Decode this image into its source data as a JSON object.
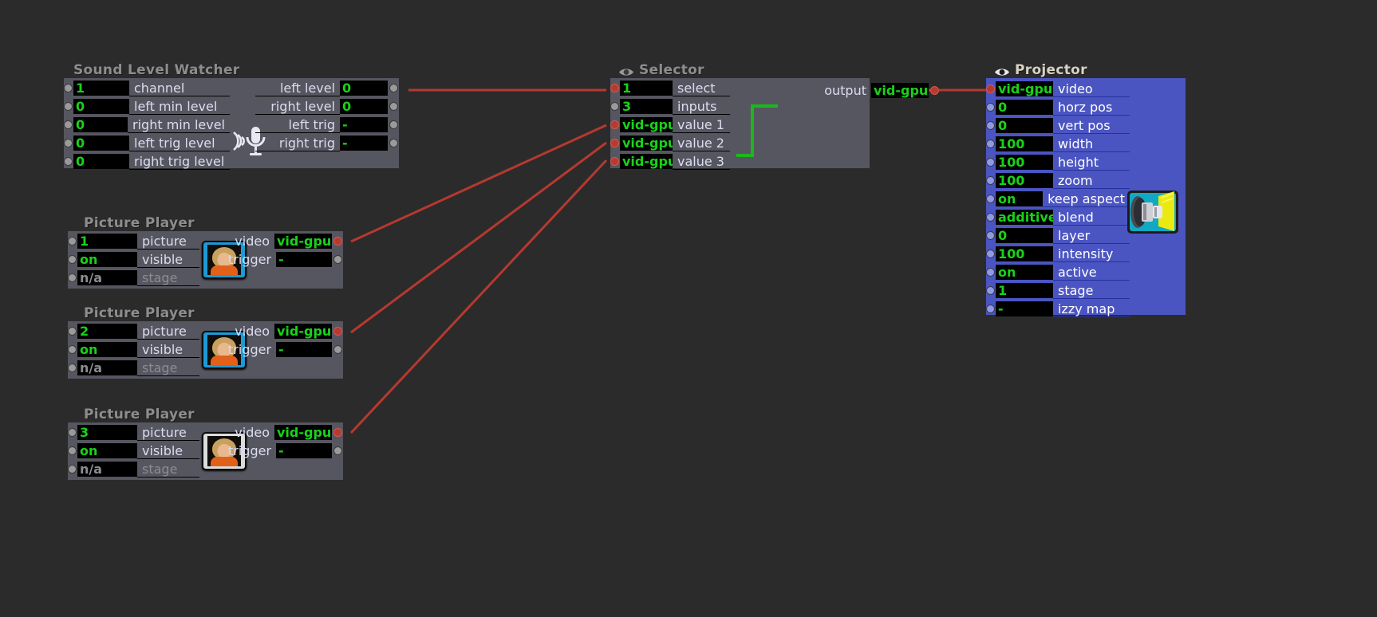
{
  "app": {
    "background_color": "#2b2b2b",
    "node_body_color": "#565660",
    "selected_node_color": "#4b55c2",
    "value_text_color": "#19d219",
    "wire_color": "#b5392f",
    "internal_link_color": "#1bb81b"
  },
  "nodes": {
    "sound_level_watcher": {
      "title": "Sound Level Watcher",
      "icon": "microphone-icon",
      "inputs": [
        {
          "value": "1",
          "label": "channel"
        },
        {
          "value": "0",
          "label": "left min level"
        },
        {
          "value": "0",
          "label": "right min level"
        },
        {
          "value": "0",
          "label": "left trig level"
        },
        {
          "value": "0",
          "label": "right trig level"
        }
      ],
      "outputs": [
        {
          "label": "left level",
          "value": "0"
        },
        {
          "label": "right level",
          "value": "0"
        },
        {
          "label": "left trig",
          "value": "-"
        },
        {
          "label": "right trig",
          "value": "-"
        }
      ]
    },
    "selector": {
      "title": "Selector",
      "icon": "eye-icon",
      "inputs": [
        {
          "value": "1",
          "label": "select",
          "connected": true
        },
        {
          "value": "3",
          "label": "inputs",
          "connected": false
        },
        {
          "value": "vid-gpu",
          "label": "value 1",
          "connected": true
        },
        {
          "value": "vid-gpu",
          "label": "value 2",
          "connected": true
        },
        {
          "value": "vid-gpu",
          "label": "value 3",
          "connected": true
        }
      ],
      "outputs": [
        {
          "label": "output",
          "value": "vid-gpu"
        }
      ]
    },
    "projector": {
      "title": "Projector",
      "icon": "eye-icon",
      "selected": true,
      "thumbnail_icon": "projector-icon",
      "inputs": [
        {
          "value": "vid-gpu",
          "label": "video",
          "connected": true
        },
        {
          "value": "0",
          "label": "horz pos",
          "connected": false
        },
        {
          "value": "0",
          "label": "vert pos",
          "connected": false
        },
        {
          "value": "100",
          "label": "width",
          "connected": false
        },
        {
          "value": "100",
          "label": "height",
          "connected": false
        },
        {
          "value": "100",
          "label": "zoom",
          "connected": false
        },
        {
          "value": "on",
          "label": "keep aspect",
          "connected": false
        },
        {
          "value": "additive",
          "label": "blend",
          "connected": false
        },
        {
          "value": "0",
          "label": "layer",
          "connected": false
        },
        {
          "value": "100",
          "label": "intensity",
          "connected": false
        },
        {
          "value": "on",
          "label": "active",
          "connected": false
        },
        {
          "value": "1",
          "label": "stage",
          "connected": false
        },
        {
          "value": "-",
          "label": "izzy map",
          "connected": false
        }
      ]
    },
    "picture_players": [
      {
        "title": "Picture Player",
        "thumbnail_icon": "picture-thumbnail",
        "thumbnail_frame": "dark",
        "inputs": [
          {
            "value": "1",
            "label": "picture",
            "dim": false
          },
          {
            "value": "on",
            "label": "visible",
            "dim": false
          },
          {
            "value": "n/a",
            "label": "stage",
            "dim": true
          }
        ],
        "outputs": [
          {
            "label": "video",
            "value": "vid-gpu"
          },
          {
            "label": "trigger",
            "value": "-"
          }
        ]
      },
      {
        "title": "Picture Player",
        "thumbnail_icon": "picture-thumbnail",
        "thumbnail_frame": "dark",
        "inputs": [
          {
            "value": "2",
            "label": "picture",
            "dim": false
          },
          {
            "value": "on",
            "label": "visible",
            "dim": false
          },
          {
            "value": "n/a",
            "label": "stage",
            "dim": true
          }
        ],
        "outputs": [
          {
            "label": "video",
            "value": "vid-gpu"
          },
          {
            "label": "trigger",
            "value": "-"
          }
        ]
      },
      {
        "title": "Picture Player",
        "thumbnail_icon": "picture-thumbnail",
        "thumbnail_frame": "light",
        "inputs": [
          {
            "value": "3",
            "label": "picture",
            "dim": false
          },
          {
            "value": "on",
            "label": "visible",
            "dim": false
          },
          {
            "value": "n/a",
            "label": "stage",
            "dim": true
          }
        ],
        "outputs": [
          {
            "label": "video",
            "value": "vid-gpu"
          },
          {
            "label": "trigger",
            "value": "-"
          }
        ]
      }
    ]
  }
}
